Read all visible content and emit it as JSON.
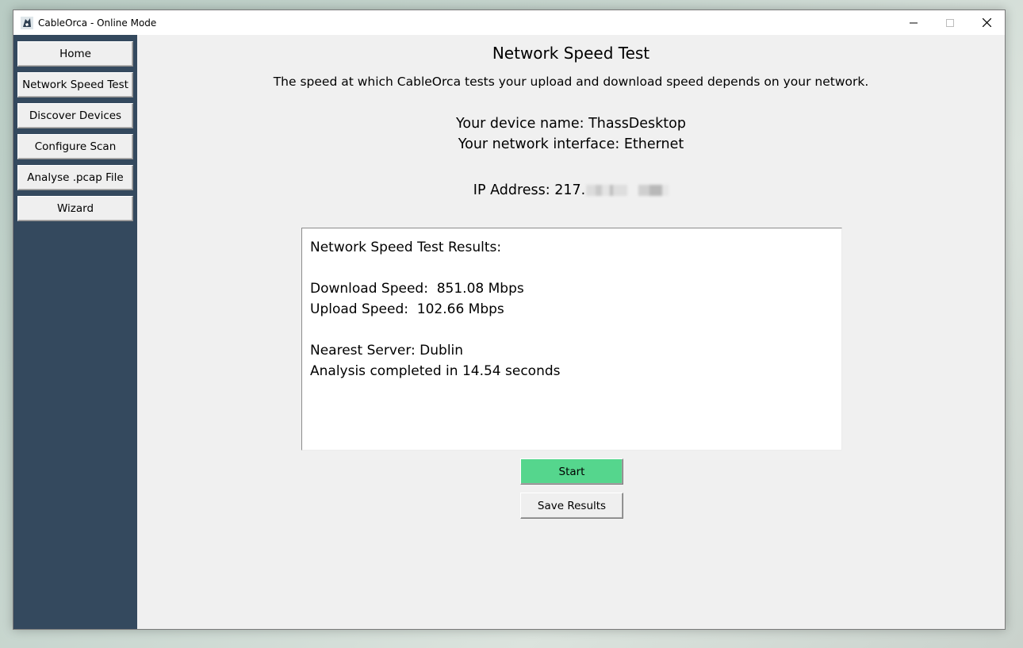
{
  "window": {
    "title": "CableOrca - Online Mode"
  },
  "sidebar": {
    "items": [
      {
        "label": "Home"
      },
      {
        "label": "Network Speed Test"
      },
      {
        "label": "Discover Devices"
      },
      {
        "label": "Configure Scan"
      },
      {
        "label": "Analyse .pcap File"
      },
      {
        "label": "Wizard"
      }
    ]
  },
  "main": {
    "heading": "Network Speed Test",
    "description": "The speed at which CableOrca tests your upload and download speed depends on your network.",
    "device_name": "Your device name: ThassDesktop",
    "network_interface": "Your network interface: Ethernet",
    "ip_address": "IP Address: 217."
  },
  "results": {
    "title": "Network Speed Test Results:",
    "download": "Download Speed:  851.08 Mbps",
    "upload": "Upload Speed:  102.66 Mbps",
    "server": "Nearest Server: Dublin",
    "duration": "Analysis completed in 14.54 seconds"
  },
  "buttons": {
    "start": "Start",
    "save": "Save Results"
  },
  "colors": {
    "sidebar_bg": "#34495e",
    "start_button": "#55d68d",
    "window_bg": "#f0f0f0"
  }
}
